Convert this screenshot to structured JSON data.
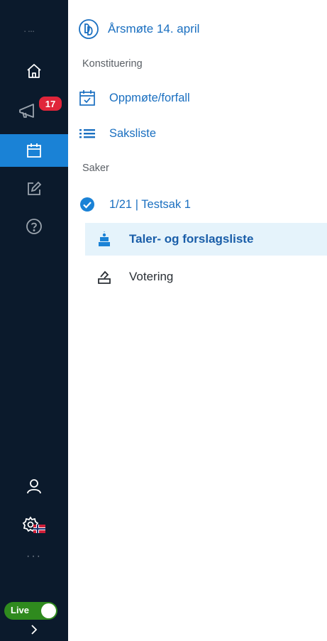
{
  "rail": {
    "logo_text": "▪ ▪▪▪",
    "notification_count": "17",
    "more_label": "···",
    "live_label": "Live",
    "live_on": true,
    "colors": {
      "background": "#0b1a2c",
      "active": "#1a82d6",
      "badge": "#e0253a",
      "live": "#2f8a1e"
    }
  },
  "meeting": {
    "title": "Årsmøte 14. april"
  },
  "sections": {
    "konstituering": "Konstituering",
    "saker": "Saker"
  },
  "nav": {
    "attendance": "Oppmøte/forfall",
    "agenda": "Saksliste",
    "case": "1/21 | Testsak 1",
    "speakers": "Taler- og forslagsliste",
    "voting": "Votering"
  },
  "colors": {
    "accent": "#1a6fc0",
    "selected_bg": "#e5f3fb"
  }
}
